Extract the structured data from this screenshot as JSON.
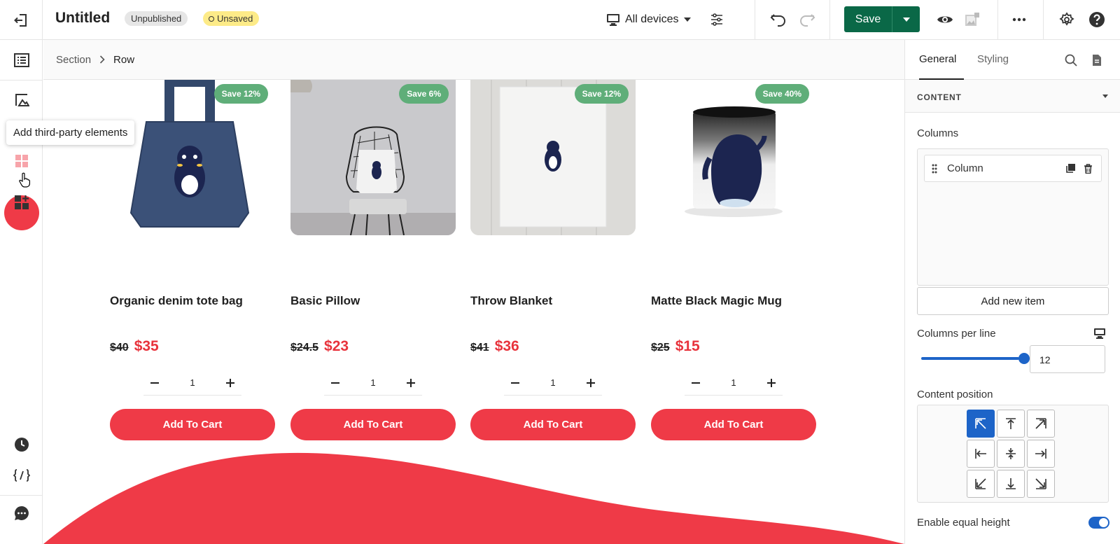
{
  "app": {
    "title": "Untitled",
    "status_badges": [
      "Unpublished",
      "Unsaved"
    ],
    "device_selector": "All devices",
    "save_label": "Save"
  },
  "sidebar": {
    "tooltip": "Add third-party elements",
    "icons": [
      "layers-icon",
      "image-elements-icon",
      "apps-icon",
      "add-widget-icon",
      "history-icon",
      "code-icon",
      "chat-icon"
    ]
  },
  "breadcrumb": {
    "items": [
      "Section",
      "Row"
    ]
  },
  "products": [
    {
      "name": "Organic denim tote bag",
      "old_price": "$40",
      "new_price": "$35",
      "badge": "Save 12%",
      "qty": "1",
      "cta": "Add To Cart"
    },
    {
      "name": "Basic Pillow",
      "old_price": "$24.5",
      "new_price": "$23",
      "badge": "Save 6%",
      "qty": "1",
      "cta": "Add To Cart"
    },
    {
      "name": "Throw Blanket",
      "old_price": "$41",
      "new_price": "$36",
      "badge": "Save 12%",
      "qty": "1",
      "cta": "Add To Cart"
    },
    {
      "name": "Matte Black Magic Mug",
      "old_price": "$25",
      "new_price": "$15",
      "badge": "Save 40%",
      "qty": "1",
      "cta": "Add To Cart"
    }
  ],
  "panel": {
    "tabs": [
      "General",
      "Styling"
    ],
    "section_title": "CONTENT",
    "columns_label": "Columns",
    "column_item": "Column",
    "add_item": "Add new item",
    "columns_per_line_label": "Columns per line",
    "columns_per_line_value": "12",
    "content_position_label": "Content position",
    "content_position_selected": "top-left",
    "equal_height_label": "Enable equal height",
    "equal_height_enabled": true
  },
  "colors": {
    "accent_red": "#ef3a47",
    "save_green": "#0a6847",
    "badge_green": "#5fae79",
    "primary_blue": "#1d64c8"
  }
}
